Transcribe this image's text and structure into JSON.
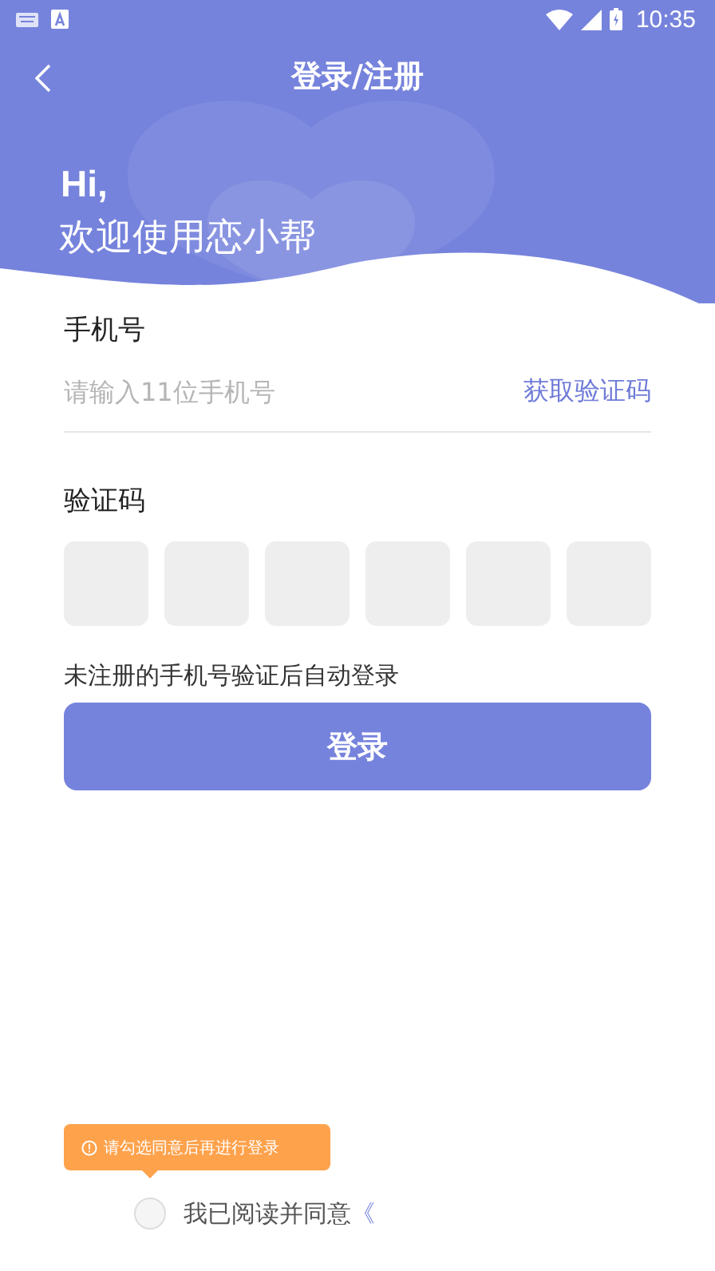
{
  "status_bar": {
    "time": "10:35"
  },
  "header": {
    "title": "登录/注册",
    "greeting": "Hi,",
    "welcome": "欢迎使用恋小帮"
  },
  "phone": {
    "label": "手机号",
    "placeholder": "请输入11位手机号",
    "code_link": "获取验证码"
  },
  "code": {
    "label": "验证码",
    "boxes": [
      {
        "filled": false
      },
      {
        "filled": false
      },
      {
        "filled": false
      },
      {
        "filled": false
      },
      {
        "filled": false
      },
      {
        "filled": false
      }
    ]
  },
  "note": "未注册的手机号验证后自动登录",
  "login_button": "登录",
  "tooltip": "请勾选同意后再进行登录",
  "agreement": {
    "checked": false,
    "text": "我已阅读并同意",
    "link": "《"
  }
}
